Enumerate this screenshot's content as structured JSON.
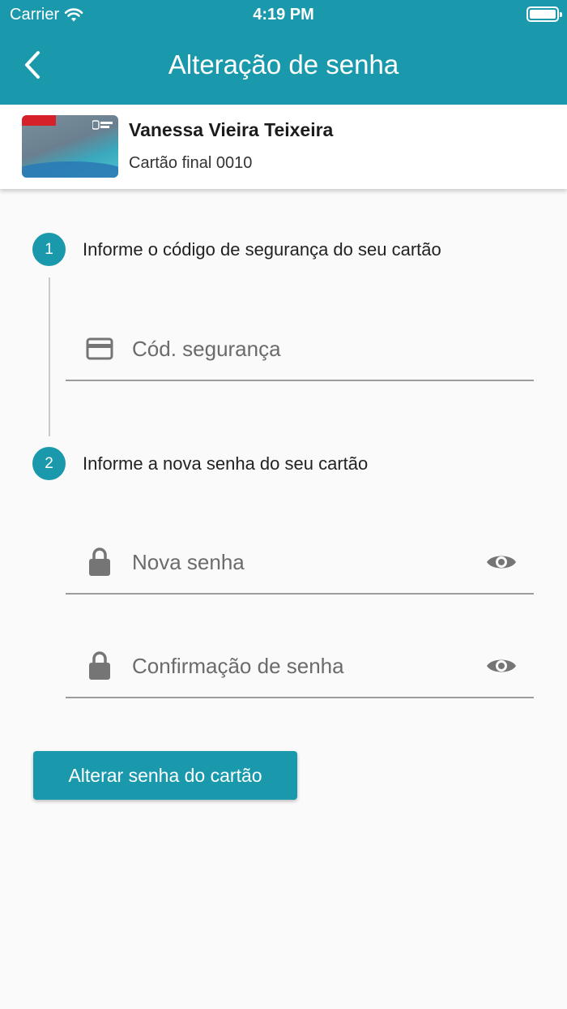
{
  "status_bar": {
    "carrier": "Carrier",
    "time": "4:19 PM"
  },
  "header": {
    "title": "Alteração de senha"
  },
  "card": {
    "holder_name": "Vanessa Vieira Teixeira",
    "card_ending": "Cartão final 0010"
  },
  "steps": [
    {
      "number": "1",
      "text": "Informe o código de segurança do seu cartão"
    },
    {
      "number": "2",
      "text": "Informe a nova senha do seu cartão"
    }
  ],
  "fields": {
    "security_code": {
      "placeholder": "Cód. segurança",
      "icon": "credit-card-icon"
    },
    "new_password": {
      "placeholder": "Nova senha",
      "icon": "lock-icon"
    },
    "confirm_password": {
      "placeholder": "Confirmação de senha",
      "icon": "lock-icon"
    }
  },
  "actions": {
    "submit_label": "Alterar senha do cartão"
  },
  "colors": {
    "primary": "#1a99ad",
    "background": "#fafafa",
    "icon_gray": "#757575"
  }
}
